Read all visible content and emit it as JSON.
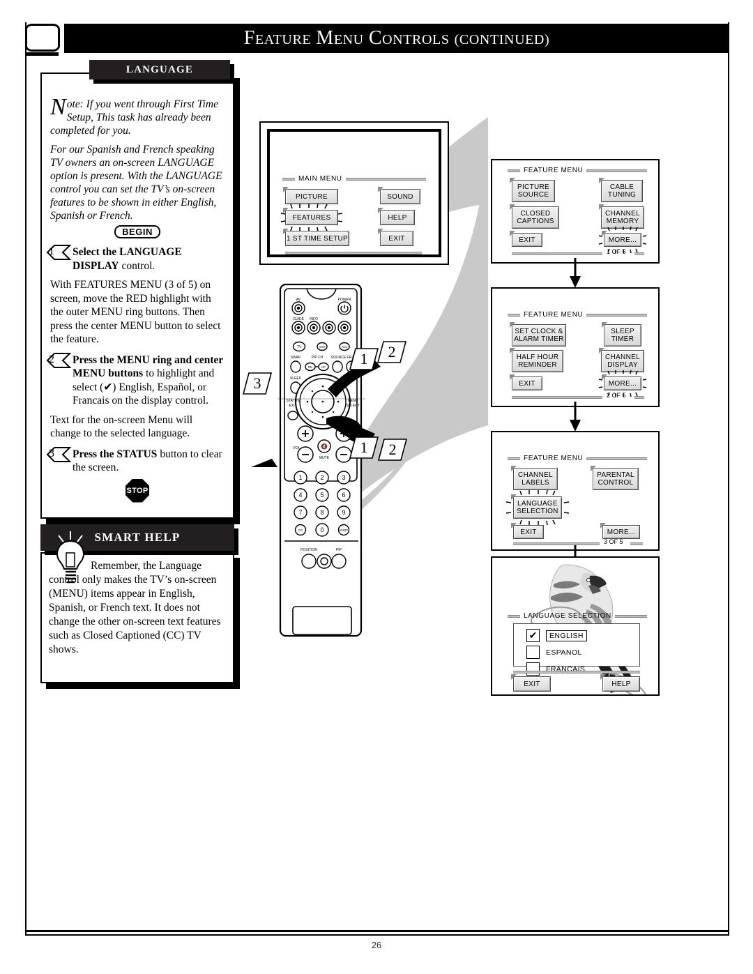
{
  "header": {
    "title_parts": [
      "F",
      "EATURE ",
      "M",
      "ENU ",
      "C",
      "ONTROLS (",
      "CONTINUED",
      ")"
    ],
    "title": "FEATURE MENU CONTROLS (CONTINUED)",
    "tv_icon": "tv-screen-icon"
  },
  "page": {
    "number": "26"
  },
  "language_panel": {
    "title": "LANGUAGE",
    "note_dropcap": "N",
    "note_rest": "ote: If you went through First Time Setup, This task has already been completed for you.",
    "intro": "For our Spanish and French speaking TV owners an on-screen LANGUAGE option is present. With the LANGUAGE control you can set the TV’s on-screen features to be shown in either English, Spanish or French.",
    "begin_label": "BEGIN",
    "steps": [
      {
        "num": "1",
        "bold": "Select the LANGUAGE DISPLAY",
        "rest": " control.",
        "body": "With FEATURES MENU (3 of 5) on screen, move the RED highlight with the outer MENU ring buttons. Then press the center MENU button to select the feature."
      },
      {
        "num": "2",
        "bold": "Press the MENU ring and center MENU buttons",
        "rest": " to highlight and select (✔) English, Español, or Francais on the display control.",
        "body": "Text for the on-screen Menu will change to the selected language."
      },
      {
        "num": "3",
        "bold": "Press the STATUS",
        "rest": " button to clear the screen.",
        "body": ""
      }
    ],
    "stop_label": "STOP"
  },
  "smart_help": {
    "title": "SMART HELP",
    "icon": "lightbulb-icon",
    "text": "Remember, the Language control only makes the TV’s on-screen (MENU) items appear in English, Spanish, or French text. It does not change the other on-screen text features such as Closed Captioned (CC) TV shows."
  },
  "main_menu_screen": {
    "header": "MAIN MENU",
    "buttons": [
      {
        "label": "PICTURE",
        "highlighted": false
      },
      {
        "label": "SOUND",
        "highlighted": false
      },
      {
        "label": "FEATURES",
        "highlighted": true
      },
      {
        "label": "HELP",
        "highlighted": false
      },
      {
        "label": "1 ST TIME SETUP",
        "highlighted": false
      },
      {
        "label": "EXIT",
        "highlighted": false
      }
    ]
  },
  "remote": {
    "name": "remote-control",
    "labels": {
      "av": "AV",
      "power": "POWER",
      "guide": "GUIDE",
      "info": "INFO",
      "tv": "TV",
      "vcr": "VCR",
      "acc": "ACC",
      "swap": "SWAP",
      "pipch": "PIP CH",
      "dn": "DN",
      "up": "UP",
      "source": "SOURCE FREEZE",
      "sleep": "SLEEP",
      "status": "STATUS",
      "exit": "EXIT",
      "menu": "MENU",
      "select": "SELECT",
      "vol": "VOL",
      "mute": "MUTE",
      "position": "POSITION",
      "pip": "PIP",
      "keys": [
        "1",
        "2",
        "3",
        "4",
        "5",
        "6",
        "7",
        "8",
        "9",
        "CC",
        "0",
        "SURF"
      ]
    },
    "callouts": [
      "1",
      "2",
      "3",
      "1",
      "2"
    ]
  },
  "feature_menus": [
    {
      "name": "feature-menu-1-of-5",
      "header": "FEATURE MENU",
      "page_label": "1  OF 5",
      "buttons": [
        {
          "label": "PICTURE\nSOURCE",
          "highlighted": false
        },
        {
          "label": "CABLE\nTUNING",
          "highlighted": false
        },
        {
          "label": "CLOSED\nCAPTIONS",
          "highlighted": false
        },
        {
          "label": "CHANNEL\nMEMORY",
          "highlighted": false
        },
        {
          "label": "EXIT",
          "highlighted": false
        },
        {
          "label": "MORE...",
          "highlighted": true
        }
      ]
    },
    {
      "name": "feature-menu-2-of-5",
      "header": "FEATURE MENU",
      "page_label": "2  OF 5",
      "buttons": [
        {
          "label": "SET CLOCK &\nALARM  TIMER",
          "highlighted": false
        },
        {
          "label": "SLEEP\nTIMER",
          "highlighted": false
        },
        {
          "label": "HALF HOUR\nREMINDER",
          "highlighted": false
        },
        {
          "label": "CHANNEL\nDISPLAY",
          "highlighted": false
        },
        {
          "label": "EXIT",
          "highlighted": false
        },
        {
          "label": "MORE...",
          "highlighted": true
        }
      ]
    },
    {
      "name": "feature-menu-3-of-5",
      "header": "FEATURE MENU",
      "page_label": "3  OF 5",
      "buttons": [
        {
          "label": "CHANNEL\nLABELS",
          "highlighted": false
        },
        {
          "label": "PARENTAL\nCONTROL",
          "highlighted": false
        },
        {
          "label": "LANGUAGE\nSELECTION",
          "highlighted": true
        },
        {
          "label": "EXIT",
          "highlighted": false
        },
        {
          "label": "MORE...",
          "highlighted": false
        }
      ]
    }
  ],
  "language_selection_screen": {
    "name": "language-selection-screen",
    "header": "LANGUAGE SELECTION",
    "options": [
      {
        "label": "ENGLISH",
        "checked": true,
        "boxed": true
      },
      {
        "label": "ESPANOL",
        "checked": false,
        "boxed": false
      },
      {
        "label": "FRANCAIS",
        "checked": false,
        "boxed": false
      }
    ],
    "check_glyph": "✔",
    "exit_label": "EXIT",
    "help_label": "HELP",
    "decor": "parrot-illustration"
  },
  "colors": {
    "ink": "#000000",
    "panel_header_bg": "#231f20",
    "osd_button_face": "#d9d9d9",
    "osd_rule": "#bfbfbf",
    "swoosh_gray": "#c9c9c9"
  }
}
